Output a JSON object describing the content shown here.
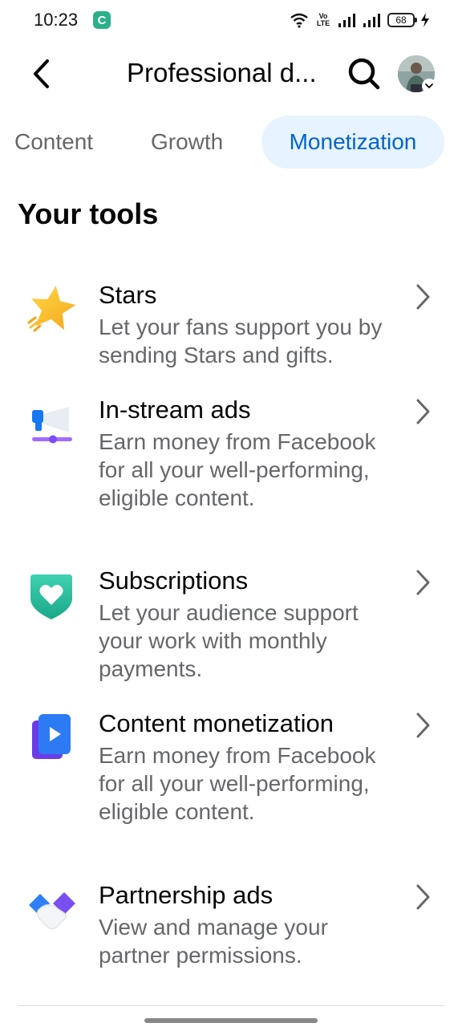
{
  "status_bar": {
    "time": "10:23",
    "app_icon_letter": "C",
    "network_label": "Vo LTE",
    "battery_level": "68"
  },
  "header": {
    "title": "Professional d..."
  },
  "tabs": [
    {
      "label": "Content",
      "selected": false
    },
    {
      "label": "Growth",
      "selected": false
    },
    {
      "label": "Monetization",
      "selected": true
    }
  ],
  "section": {
    "title": "Your tools"
  },
  "tools": [
    {
      "title": "Stars",
      "description": "Let your fans support you by sending Stars and gifts.",
      "icon": "star-icon"
    },
    {
      "title": "In-stream ads",
      "description": "Earn money from Facebook for all your well-performing, eligible content.",
      "icon": "megaphone-icon"
    },
    {
      "title": "Subscriptions",
      "description": "Let your audience support your work with monthly payments.",
      "icon": "heart-shield-icon"
    },
    {
      "title": "Content monetization",
      "description": "Earn money from Facebook for all your well-performing, eligible content.",
      "icon": "play-card-icon"
    },
    {
      "title": "Partnership ads",
      "description": "View and manage your partner permissions.",
      "icon": "handshake-icon"
    }
  ],
  "colors": {
    "accent": "#0064d1",
    "accent_bg": "#e7f3ff",
    "secondary_text": "#65676b",
    "primary_text": "#050505"
  }
}
